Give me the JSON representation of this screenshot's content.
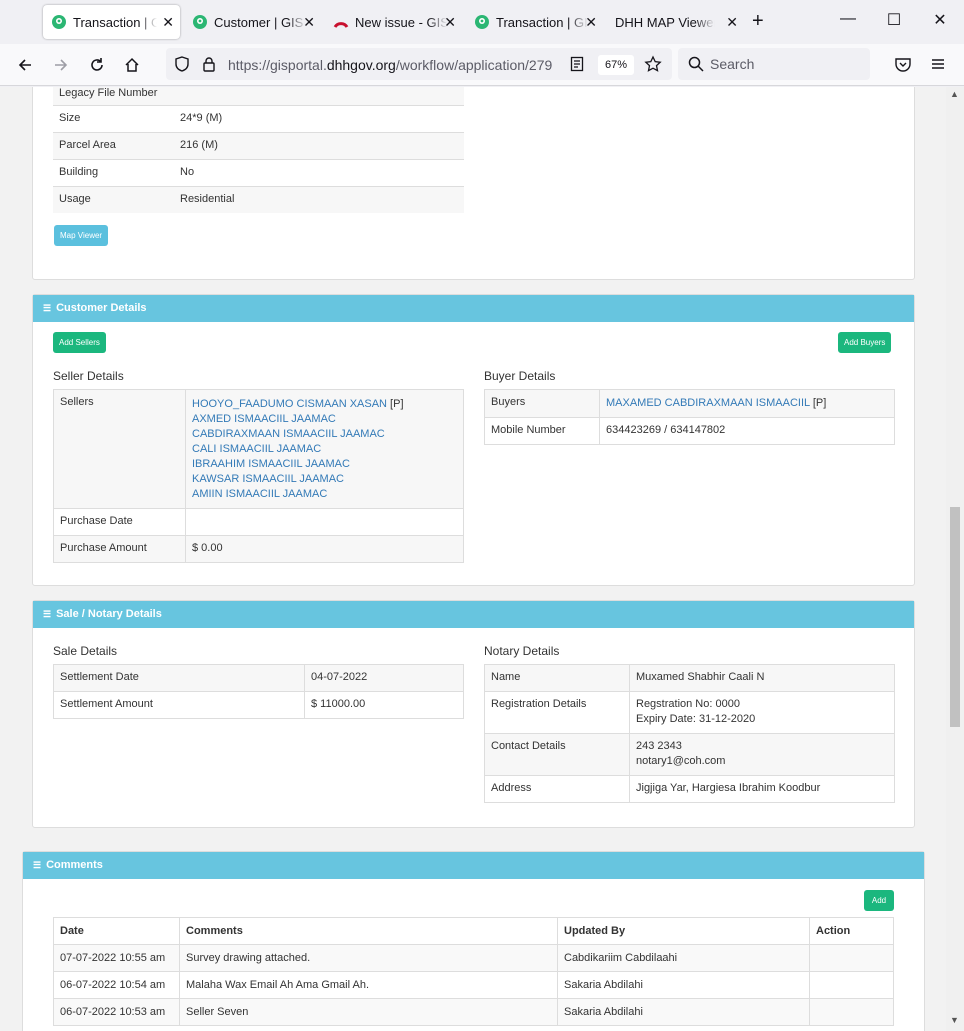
{
  "browser": {
    "tabs": [
      {
        "label": "Transaction | GIS Portal",
        "active": true
      },
      {
        "label": "Customer | GIS Portal",
        "active": false
      },
      {
        "label": "New issue - GIS",
        "active": false
      },
      {
        "label": "Transaction | GIS Portal",
        "active": false
      },
      {
        "label": "DHH MAP Viewer",
        "active": false
      }
    ],
    "url_prefix": "https://gisportal.",
    "url_domain": "dhhgov.org",
    "url_path": "/workflow/application/279",
    "zoom": "67%",
    "search_placeholder": "Search"
  },
  "parcel": {
    "rows": [
      {
        "label": "Legacy File Number",
        "value": ""
      },
      {
        "label": "Size",
        "value": "24*9 (M)"
      },
      {
        "label": "Parcel Area",
        "value": "216 (M)"
      },
      {
        "label": "Building",
        "value": "No"
      },
      {
        "label": "Usage",
        "value": "Residential"
      }
    ],
    "map_viewer_label": "Map Viewer"
  },
  "customer": {
    "title": "Customer Details",
    "add_sellers_label": "Add Sellers",
    "add_buyers_label": "Add Buyers",
    "seller_title": "Seller Details",
    "buyer_title": "Buyer Details",
    "sellers_label": "Sellers",
    "sellers": [
      "HOOYO_FAADUMO CISMAAN XASAN",
      "AXMED ISMAACIIL JAAMAC",
      "CABDIRAXMAAN ISMAACIIL JAAMAC",
      "CALI ISMAACIIL JAAMAC",
      "IBRAAHIM ISMAACIIL JAAMAC",
      "KAWSAR ISMAACIIL JAAMAC",
      "AMIIN ISMAACIIL JAAMAC"
    ],
    "primary_tag": "[P]",
    "purchase_date_label": "Purchase Date",
    "purchase_date": "",
    "purchase_amount_label": "Purchase Amount",
    "purchase_amount": "$ 0.00",
    "buyers_label": "Buyers",
    "buyer": "MAXAMED CABDIRAXMAAN ISMAACIIL",
    "mobile_label": "Mobile Number",
    "mobile": "634423269 / 634147802"
  },
  "sale": {
    "title": "Sale / Notary Details",
    "sale_title": "Sale Details",
    "notary_title": "Notary Details",
    "settlement_date_label": "Settlement Date",
    "settlement_date": "04-07-2022",
    "settlement_amount_label": "Settlement Amount",
    "settlement_amount": "$ 11000.00",
    "name_label": "Name",
    "name": "Muxamed Shabhir Caali N",
    "registration_label": "Registration Details",
    "registration_no": "Regstration No: 0000",
    "expiry": "Expiry Date: 31-12-2020",
    "contact_label": "Contact Details",
    "phone": "243 2343",
    "email": "notary1@coh.com",
    "address_label": "Address",
    "address": "Jigjiga Yar, Hargiesa Ibrahim Koodbur"
  },
  "comments": {
    "title": "Comments",
    "add_label": "Add",
    "columns": [
      "Date",
      "Comments",
      "Updated By",
      "Action"
    ],
    "rows": [
      {
        "date": "07-07-2022 10:55 am",
        "comment": "Survey drawing attached.",
        "by": "Cabdikariim Cabdilaahi",
        "action": ""
      },
      {
        "date": "06-07-2022 10:54 am",
        "comment": "Malaha Wax Email Ah Ama Gmail Ah.",
        "by": "Sakaria Abdilahi",
        "action": ""
      },
      {
        "date": "06-07-2022 10:53 am",
        "comment": "Seller Seven",
        "by": "Sakaria Abdilahi",
        "action": ""
      }
    ]
  }
}
